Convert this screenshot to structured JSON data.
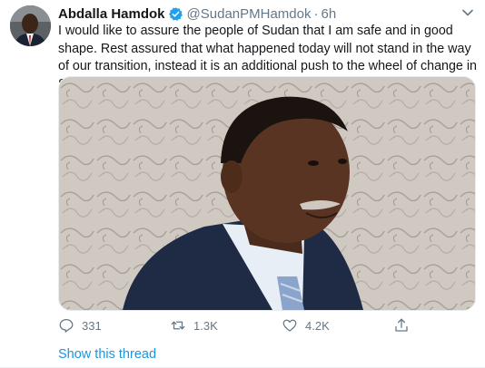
{
  "tweet": {
    "display_name": "Abdalla Hamdok",
    "handle": "@SudanPMHamdok",
    "separator": "·",
    "time": "6h",
    "text": "I would like to assure the people of Sudan that I am safe and in good shape. Rest assured that what happened today will not stand in the way of our transition, instead it is an additional push to the wheel of change in Sudan.",
    "verified_icon": "verified-badge-icon",
    "colors": {
      "text": "#14171a",
      "muted": "#657786",
      "link": "#1b95e0",
      "verified": "#1da1f2"
    }
  },
  "actions": {
    "replies": "331",
    "retweets": "1.3K",
    "likes": "4.2K",
    "share_icon": "share-icon"
  },
  "footer": {
    "show_thread": "Show this thread"
  }
}
